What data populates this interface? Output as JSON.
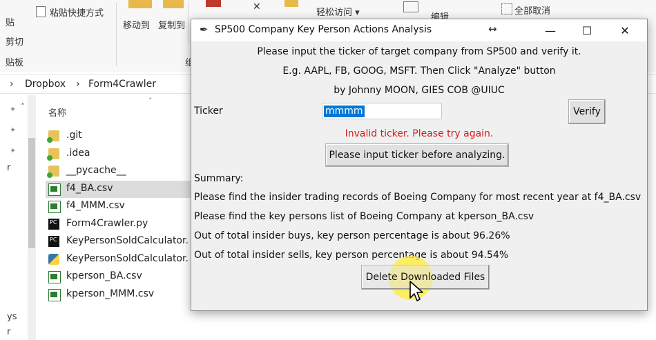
{
  "explorer": {
    "ribbon": {
      "paste_label": "贴",
      "cut_label": "剪切",
      "clipboard_group": "贴板",
      "paste_shortcut": "粘贴快捷方式",
      "move_to": "移动到",
      "copy_to": "复制到",
      "organize_group_partial": "组",
      "easy_access": "轻松访问 ▾",
      "edit_label": "编辑",
      "select_none": "全部取消"
    },
    "breadcrumb": [
      "Dropbox",
      "Form4Crawler"
    ],
    "column_header": "名称",
    "left_nav_fragments": [
      "r",
      "ys",
      "r"
    ],
    "files": [
      {
        "name": ".git",
        "icon": "folder-icon"
      },
      {
        "name": ".idea",
        "icon": "folder-icon"
      },
      {
        "name": "__pycache__",
        "icon": "folder-icon"
      },
      {
        "name": "f4_BA.csv",
        "icon": "csv-icon",
        "selected": true
      },
      {
        "name": "f4_MMM.csv",
        "icon": "csv-icon"
      },
      {
        "name": "Form4Crawler.py",
        "icon": "pycharm-icon"
      },
      {
        "name": "KeyPersonSoldCalculator.",
        "icon": "pycharm-icon"
      },
      {
        "name": "KeyPersonSoldCalculator.",
        "icon": "python-icon"
      },
      {
        "name": "kperson_BA.csv",
        "icon": "csv-icon"
      },
      {
        "name": "kperson_MMM.csv",
        "icon": "csv-icon"
      }
    ]
  },
  "dialog": {
    "title": "SP500 Company Key Person Actions Analysis",
    "intro_lines": [
      "Please input the ticker of target company from SP500 and verify it.",
      "E.g. AAPL, FB, GOOG, MSFT. Then Click \"Analyze\" button",
      "by Johnny MOON, GIES COB @UIUC"
    ],
    "ticker_label": "Ticker",
    "ticker_value": "mmmm",
    "verify_button": "Verify",
    "error_text": "Invalid ticker. Please try again.",
    "analyze_button": "Please input ticker before analyzing.",
    "summary_label": "Summary:",
    "summary_lines": [
      "Please find the insider trading records of Boeing Company for most recent year at f4_BA.csv",
      "Please find the key persons list of Boeing Company at kperson_BA.csv",
      "Out of total insider buys, key person percentage is about 96.26%",
      "Out of total insider sells, key person percentage is about 94.54%"
    ],
    "delete_button": "Delete Downloaded Files"
  },
  "colors": {
    "error": "#d11c1c",
    "selection": "#0078d7",
    "cursor_highlight": "#ffec3c"
  }
}
